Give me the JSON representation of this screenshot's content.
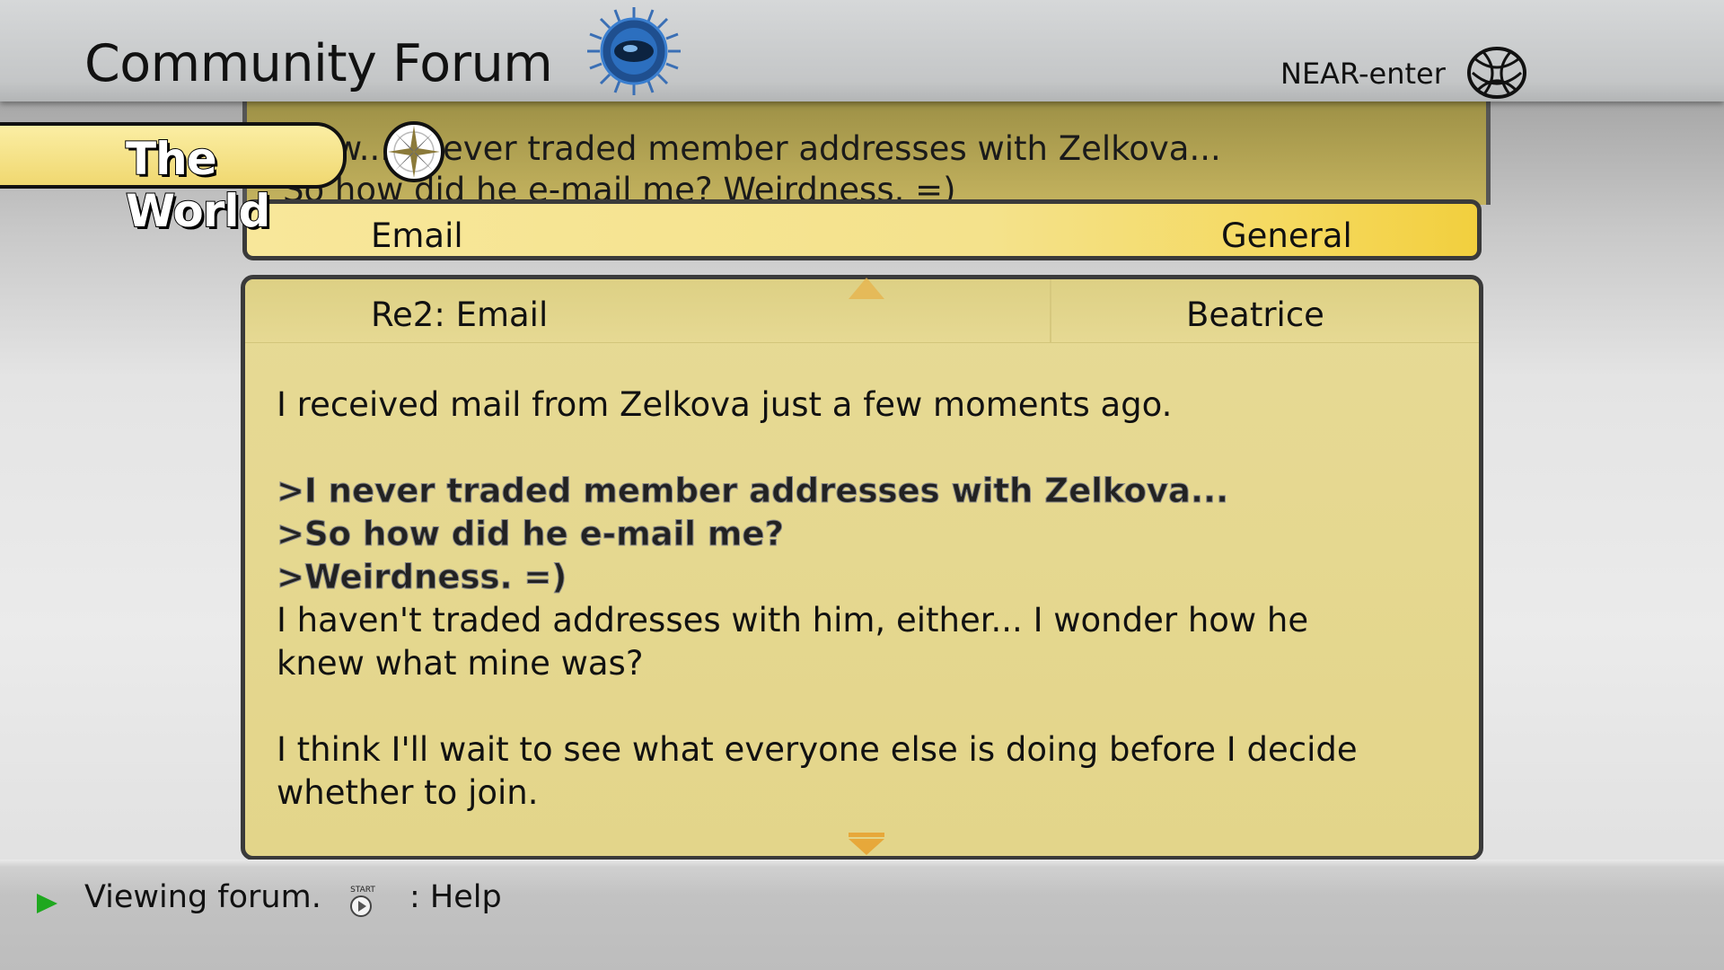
{
  "header": {
    "title": "Community Forum",
    "emblem_icon": "eye-emblem-icon",
    "near_label": "NEAR-enter",
    "globe_icon": "globe-icon"
  },
  "world_tag": {
    "label": "The World",
    "icon": "compass-icon"
  },
  "preview": {
    "line1": "...ow... I never traded member addresses with Zelkova...",
    "line2": "So how did he e-mail me? Weirdness. =)"
  },
  "thread": {
    "title": "Email",
    "category": "General"
  },
  "message": {
    "subject": "Re2: Email",
    "author": "Beatrice",
    "lines": [
      {
        "text": "I received mail from Zelkova just a few moments ago.",
        "kind": "normal"
      },
      {
        "text": "",
        "kind": "blank"
      },
      {
        "text": ">I never traded member addresses with Zelkova...",
        "kind": "quote"
      },
      {
        "text": ">So how did he e-mail me?",
        "kind": "quote"
      },
      {
        "text": ">Weirdness. =)",
        "kind": "quote"
      },
      {
        "text": "I haven't traded addresses with him, either... I wonder how he",
        "kind": "normal"
      },
      {
        "text": "knew what mine was?",
        "kind": "normal"
      },
      {
        "text": "",
        "kind": "blank"
      },
      {
        "text": "I think I'll wait to see what everyone else is doing before I decide",
        "kind": "normal"
      },
      {
        "text": "whether to join.",
        "kind": "normal"
      }
    ]
  },
  "footer": {
    "status": "Viewing forum.",
    "start_button_label": "START",
    "help_label": ": Help"
  },
  "colors": {
    "panel": "#e4d68c",
    "row_highlight": "#f2cf3e",
    "border": "#3a3a3a",
    "play_green": "#1fa81f"
  }
}
